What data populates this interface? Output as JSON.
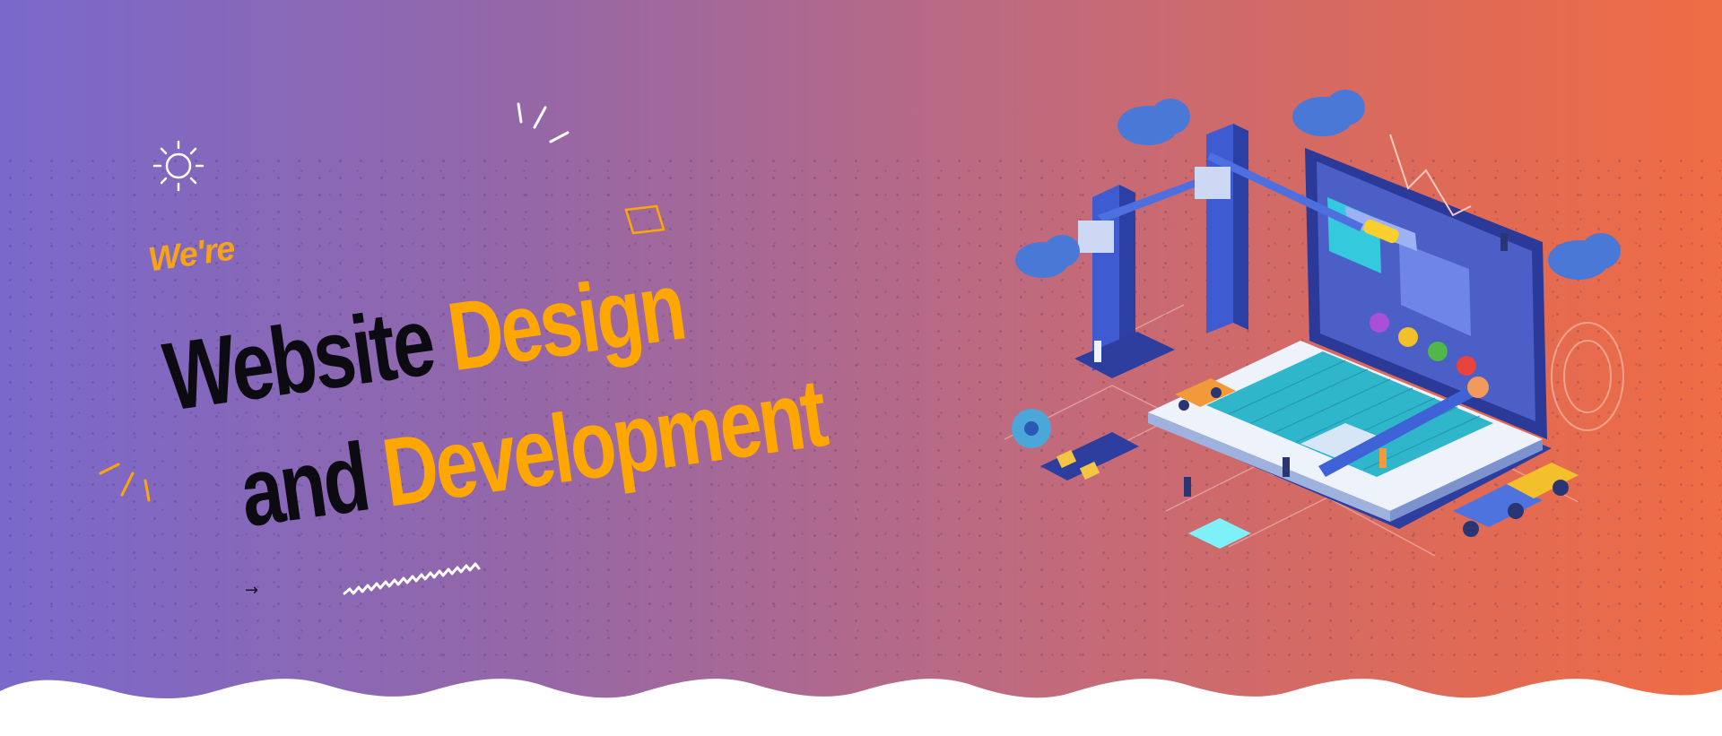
{
  "hero": {
    "kicker": "We're",
    "line1_dark": "Website",
    "line1_gold": "Design",
    "line2_dark": "and",
    "line2_gold": "Development",
    "arrow_glyph": "→"
  },
  "colors": {
    "gold": "#ffa701",
    "dark": "#0d0b12",
    "gradient_start": "#7a69cb",
    "gradient_end": "#ef6c45",
    "laptop_body": "#3e55c2",
    "screen": "#4b5fc6",
    "keyboard": "#33c6d8"
  },
  "icons": [
    "sun-icon",
    "sparkle-lines-icon",
    "diamond-outline-icon",
    "zigzag-squiggle-icon",
    "arrow-right-icon",
    "cloud-icon",
    "crane-icon",
    "gear-icon",
    "truck-icon",
    "laptop-illustration"
  ]
}
